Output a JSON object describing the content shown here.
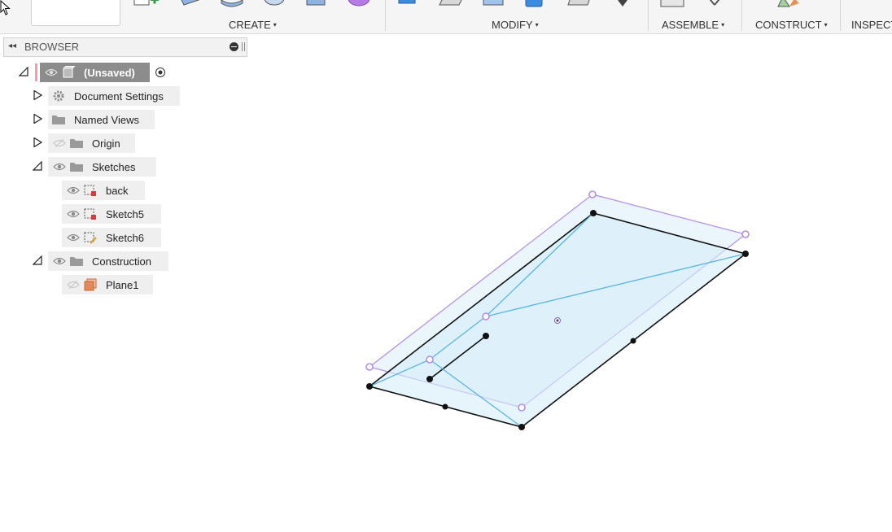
{
  "toolbar": {
    "groups": [
      {
        "label": "CREATE"
      },
      {
        "label": "MODIFY"
      },
      {
        "label": "ASSEMBLE"
      },
      {
        "label": "CONSTRUCT"
      },
      {
        "label": "INSPECT"
      }
    ],
    "caret": "▾"
  },
  "browser": {
    "title": "BROWSER",
    "root": {
      "label": "(Unsaved)"
    },
    "items": [
      {
        "label": "Document Settings",
        "icon": "gear-icon"
      },
      {
        "label": "Named Views",
        "icon": "folder-icon"
      },
      {
        "label": "Origin",
        "icon": "folder-icon"
      },
      {
        "label": "Sketches",
        "icon": "folder-icon"
      },
      {
        "label": "back",
        "icon": "sketch-icon"
      },
      {
        "label": "Sketch5",
        "icon": "sketch-icon"
      },
      {
        "label": "Sketch6",
        "icon": "sketch-icon"
      },
      {
        "label": "Construction",
        "icon": "folder-icon"
      },
      {
        "label": "Plane1",
        "icon": "plane-icon"
      }
    ]
  },
  "colors": {
    "accent_pink": "#f19bb0",
    "plane_edge": "#b48de6",
    "sketch_line": "#57b7e0",
    "plane_fill": "#e3f2fb",
    "sketch_lock": "#d63a3a",
    "plane_icon": "#e0895a"
  }
}
